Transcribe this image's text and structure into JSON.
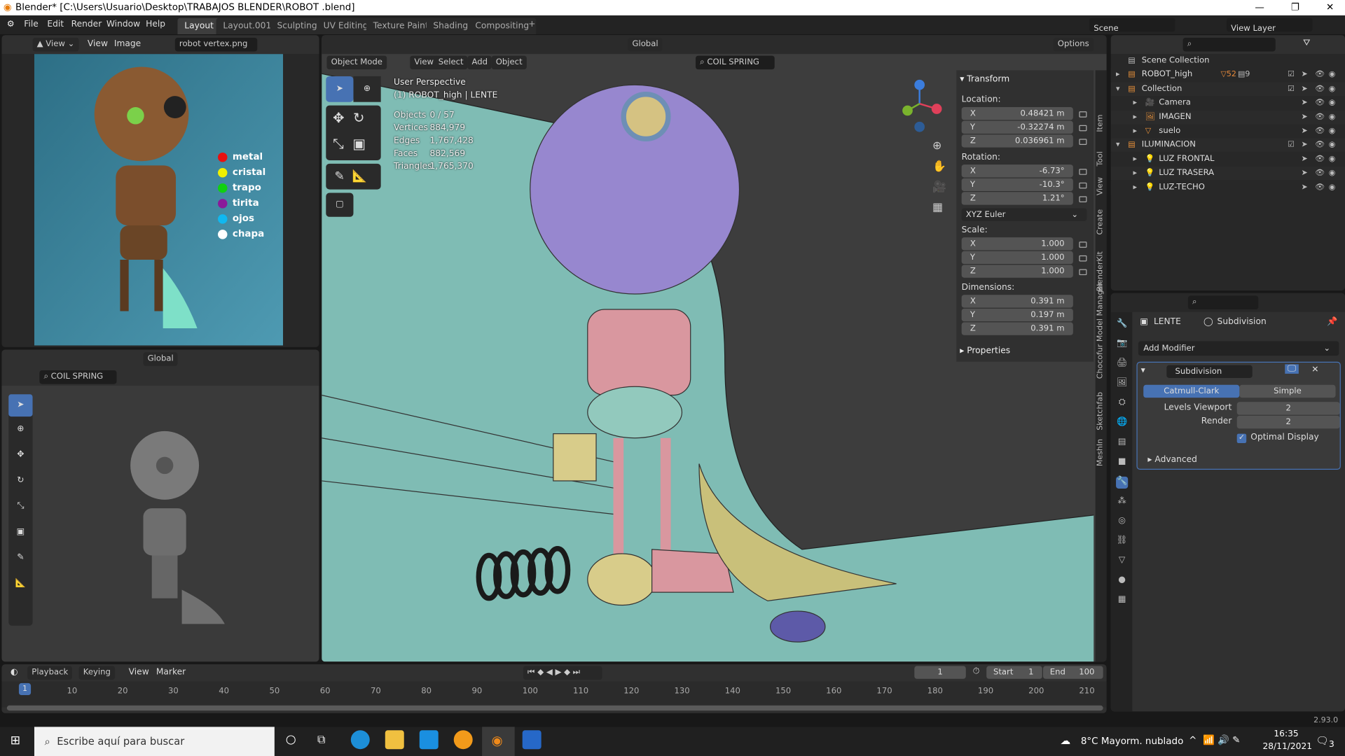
{
  "window": {
    "title": "Blender* [C:\\Users\\Usuario\\Desktop\\TRABAJOS BLENDER\\ROBOT .blend]",
    "minimize": "—",
    "maximize": "❐",
    "close": "✕"
  },
  "menu": {
    "items": [
      "File",
      "Edit",
      "Render",
      "Window",
      "Help"
    ],
    "workspaces": [
      "Layout",
      "Layout.001",
      "Sculpting",
      "UV Editing",
      "Texture Paint",
      "Shading",
      "Compositing"
    ],
    "add_tab": "+",
    "scene": "Scene",
    "view_layer": "View Layer"
  },
  "image_editor": {
    "view_menu": "View",
    "menus": [
      "View",
      "Image"
    ],
    "image_name": "robot vertex.png",
    "legend": [
      {
        "label": "metal",
        "color": "#e81010"
      },
      {
        "label": "cristal",
        "color": "#f0f000"
      },
      {
        "label": "trapo",
        "color": "#10d010"
      },
      {
        "label": "tirita",
        "color": "#8a1a9a"
      },
      {
        "label": "ojos",
        "color": "#10b8f0"
      },
      {
        "label": "chapa",
        "color": "#ffffff"
      }
    ]
  },
  "small_viewport": {
    "orientation": "Global",
    "collection": "COIL SPRING"
  },
  "viewport": {
    "orientation": "Global",
    "options": "Options",
    "mode": "Object Mode",
    "menus": [
      "View",
      "Select",
      "Add",
      "Object"
    ],
    "collection": "COIL SPRING",
    "overlay_title": "User Perspective",
    "overlay_object": "(1) ROBOT_high | LENTE",
    "stats": [
      {
        "label": "Objects",
        "value": "0 / 57"
      },
      {
        "label": "Vertices",
        "value": "884,979"
      },
      {
        "label": "Edges",
        "value": "1,767,428"
      },
      {
        "label": "Faces",
        "value": "882,569"
      },
      {
        "label": "Triangles",
        "value": "1,765,370"
      }
    ],
    "side_tabs": [
      "Item",
      "Tool",
      "View",
      "Create",
      "BlenderKit",
      "Chocofur Model Manager",
      "Sketchfab",
      "MeshIn"
    ]
  },
  "transform": {
    "title": "Transform",
    "location_label": "Location:",
    "location": [
      {
        "axis": "X",
        "value": "0.48421 m"
      },
      {
        "axis": "Y",
        "value": "-0.32274 m"
      },
      {
        "axis": "Z",
        "value": "0.036961 m"
      }
    ],
    "rotation_label": "Rotation:",
    "rotation": [
      {
        "axis": "X",
        "value": "-6.73°"
      },
      {
        "axis": "Y",
        "value": "-10.3°"
      },
      {
        "axis": "Z",
        "value": "1.21°"
      }
    ],
    "rotation_mode": "XYZ Euler",
    "scale_label": "Scale:",
    "scale": [
      {
        "axis": "X",
        "value": "1.000"
      },
      {
        "axis": "Y",
        "value": "1.000"
      },
      {
        "axis": "Z",
        "value": "1.000"
      }
    ],
    "dimensions_label": "Dimensions:",
    "dimensions": [
      {
        "axis": "X",
        "value": "0.391 m"
      },
      {
        "axis": "Y",
        "value": "0.197 m"
      },
      {
        "axis": "Z",
        "value": "0.391 m"
      }
    ],
    "properties_title": "Properties"
  },
  "outliner": {
    "root": "Scene Collection",
    "rows": [
      {
        "label": "ROBOT_high",
        "badge1": "52",
        "badge2": "9"
      },
      {
        "label": "Collection"
      },
      {
        "label": "Camera"
      },
      {
        "label": "IMAGEN"
      },
      {
        "label": "suelo"
      },
      {
        "label": "ILUMINACION"
      },
      {
        "label": "LUZ FRONTAL"
      },
      {
        "label": "LUZ TRASERA"
      },
      {
        "label": "LUZ-TECHO"
      }
    ]
  },
  "properties": {
    "object": "LENTE",
    "modifier_crumb": "Subdivision",
    "add_modifier": "Add Modifier",
    "modifier_name": "Subdivision",
    "catmull": "Catmull-Clark",
    "simple": "Simple",
    "levels_viewport_label": "Levels Viewport",
    "levels_viewport": "2",
    "render_label": "Render",
    "render": "2",
    "optimal_display": "Optimal Display",
    "optimal_checked": true,
    "advanced": "Advanced"
  },
  "timeline": {
    "menus": [
      "Playback",
      "Keying",
      "View",
      "Marker"
    ],
    "current_frame": "1",
    "start_label": "Start",
    "start": "1",
    "end_label": "End",
    "end": "100",
    "ticks": [
      "10",
      "20",
      "30",
      "40",
      "50",
      "60",
      "70",
      "80",
      "90",
      "100",
      "110",
      "120",
      "130",
      "140",
      "150",
      "160",
      "170",
      "180",
      "190",
      "200",
      "210"
    ],
    "playhead": "1"
  },
  "status": {
    "version": "2.93.0"
  },
  "taskbar": {
    "search_placeholder": "Escribe aquí para buscar",
    "weather": "8°C  Mayorm. nublado",
    "time": "16:35",
    "date": "28/11/2021",
    "notifications": "3"
  }
}
